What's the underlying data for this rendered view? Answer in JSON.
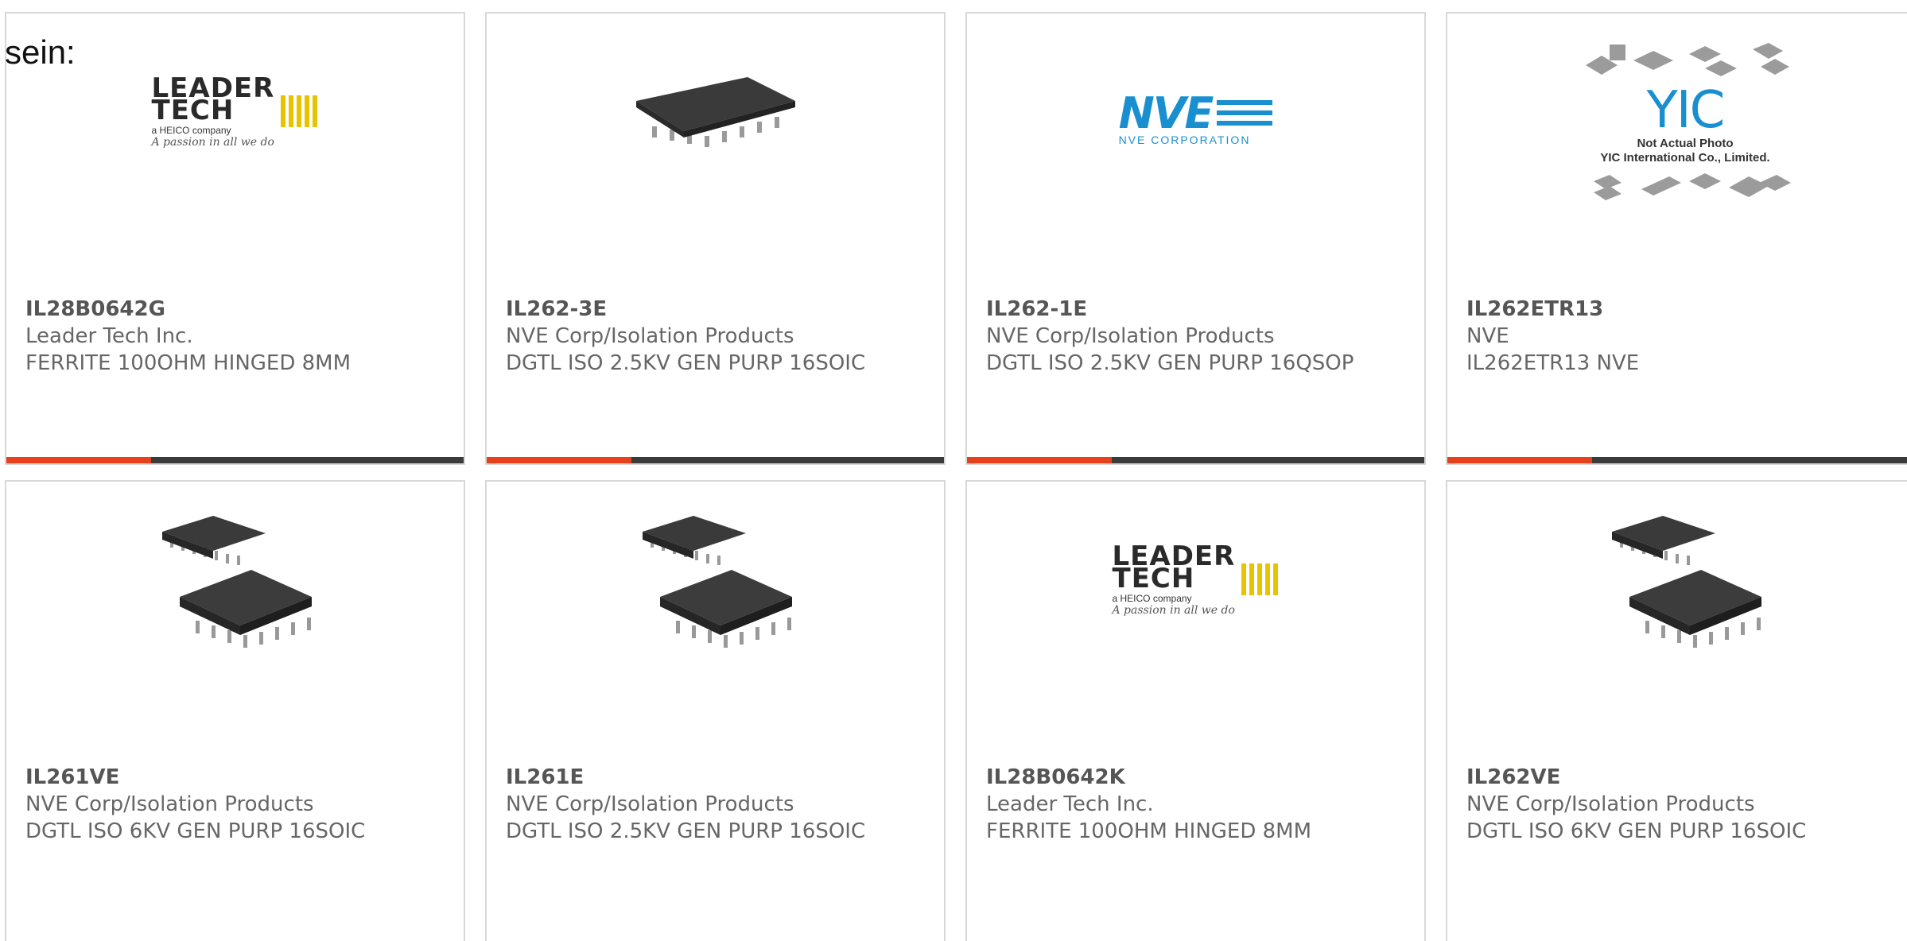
{
  "intro_text": "sein:",
  "cards": [
    {
      "part_number": "IL28B0642G",
      "manufacturer": "Leader Tech Inc.",
      "description": "FERRITE 100OHM HINGED 8MM",
      "image": "leader-tech-logo",
      "logo_word1": "LEADER",
      "logo_word2": "TECH",
      "logo_sub": "a HEICO company",
      "logo_tag": "A passion in all we do"
    },
    {
      "part_number": "IL262-3E",
      "manufacturer": "NVE Corp/Isolation Products",
      "description": "DGTL ISO 2.5KV GEN PURP 16SOIC",
      "image": "ic-soic-16-chip"
    },
    {
      "part_number": "IL262-1E",
      "manufacturer": "NVE Corp/Isolation Products",
      "description": "DGTL ISO 2.5KV GEN PURP 16QSOP",
      "image": "nve-logo",
      "logo_word": "NVE",
      "logo_sub": "NVE CORPORATION"
    },
    {
      "part_number": "IL262ETR13",
      "manufacturer": "NVE",
      "description": "IL262ETR13 NVE",
      "image": "yic-placeholder",
      "logo_word": "YIC",
      "note1": "Not Actual Photo",
      "note2": "YIC International Co., Limited."
    },
    {
      "part_number": "IL261VE",
      "manufacturer": "NVE Corp/Isolation Products",
      "description": "DGTL ISO 6KV GEN PURP 16SOIC",
      "image": "ic-two-chips"
    },
    {
      "part_number": "IL261E",
      "manufacturer": "NVE Corp/Isolation Products",
      "description": "DGTL ISO 2.5KV GEN PURP 16SOIC",
      "image": "ic-two-chips"
    },
    {
      "part_number": "IL28B0642K",
      "manufacturer": "Leader Tech Inc.",
      "description": "FERRITE 100OHM HINGED 8MM",
      "image": "leader-tech-logo",
      "logo_word1": "LEADER",
      "logo_word2": "TECH",
      "logo_sub": "a HEICO company",
      "logo_tag": "A passion in all we do"
    },
    {
      "part_number": "IL262VE",
      "manufacturer": "NVE Corp/Isolation Products",
      "description": "DGTL ISO 6KV GEN PURP 16SOIC",
      "image": "ic-two-chips"
    }
  ],
  "colors": {
    "accent_red": "#e8401a",
    "accent_dark": "#3b3b3b",
    "nve_blue": "#1a8fd0",
    "text_gray": "#666666"
  }
}
